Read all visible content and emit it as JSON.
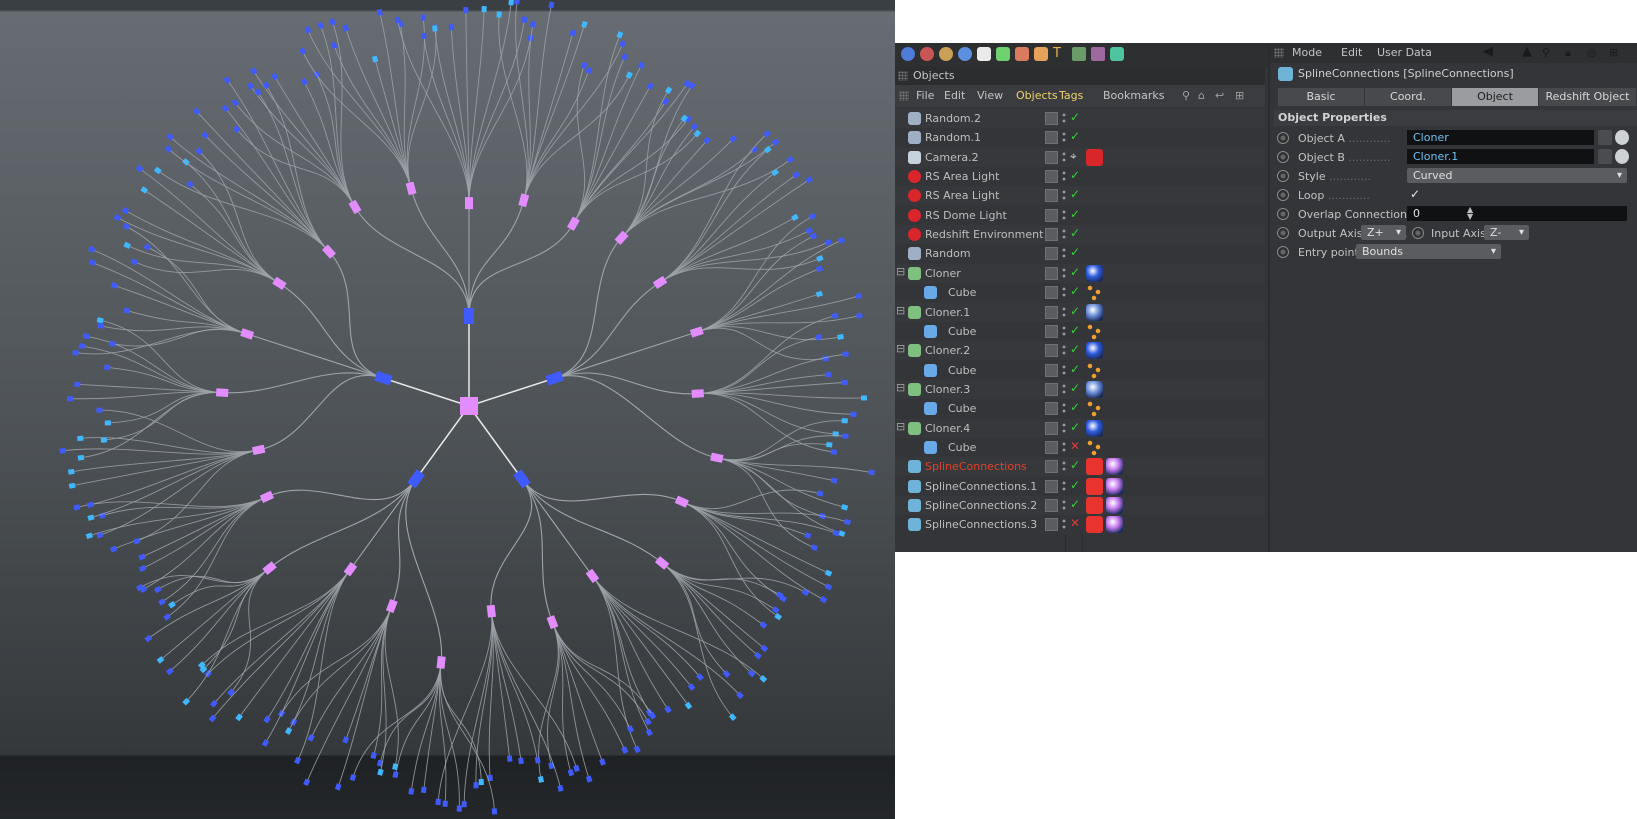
{
  "viewport": {},
  "objects_panel": {
    "title": "Objects",
    "menu": [
      "File",
      "Edit",
      "View",
      "Objects",
      "Tags",
      "Bookmarks"
    ],
    "active_menu": "Objects",
    "highlight_menu": "Tags",
    "items": [
      {
        "name": "Random.2",
        "indent": 0,
        "icon": "random-icon",
        "status": "on",
        "tags": []
      },
      {
        "name": "Random.1",
        "indent": 0,
        "icon": "random-icon",
        "status": "on",
        "tags": []
      },
      {
        "name": "Camera.2",
        "indent": 0,
        "icon": "camera-icon",
        "status": "target",
        "tags": [
          "rs-camera-tag"
        ]
      },
      {
        "name": "RS Area Light",
        "indent": 0,
        "icon": "rs-light-icon",
        "status": "on",
        "tags": []
      },
      {
        "name": "RS Area Light",
        "indent": 0,
        "icon": "rs-light-icon",
        "status": "on",
        "tags": []
      },
      {
        "name": "RS Dome Light",
        "indent": 0,
        "icon": "rs-light-icon",
        "status": "on",
        "tags": []
      },
      {
        "name": "Redshift Environment",
        "indent": 0,
        "icon": "rs-environment-icon",
        "status": "on",
        "tags": []
      },
      {
        "name": "Random",
        "indent": 0,
        "icon": "random-icon",
        "status": "on",
        "tags": []
      },
      {
        "name": "Cloner",
        "indent": 0,
        "icon": "cloner-icon",
        "status": "on",
        "tags": [
          "material-blue"
        ],
        "expand": true
      },
      {
        "name": "Cube",
        "indent": 1,
        "icon": "cube-icon",
        "status": "on",
        "tags": [
          "phong-tag"
        ]
      },
      {
        "name": "Cloner.1",
        "indent": 0,
        "icon": "cloner-icon",
        "status": "on",
        "tags": [
          "material-lightblue"
        ],
        "expand": true
      },
      {
        "name": "Cube",
        "indent": 1,
        "icon": "cube-icon",
        "status": "on",
        "tags": [
          "phong-tag"
        ]
      },
      {
        "name": "Cloner.2",
        "indent": 0,
        "icon": "cloner-icon",
        "status": "on",
        "tags": [
          "material-blue"
        ],
        "expand": true
      },
      {
        "name": "Cube",
        "indent": 1,
        "icon": "cube-icon",
        "status": "on",
        "tags": [
          "phong-tag"
        ]
      },
      {
        "name": "Cloner.3",
        "indent": 0,
        "icon": "cloner-icon",
        "status": "on",
        "tags": [
          "material-lightblue"
        ],
        "expand": true
      },
      {
        "name": "Cube",
        "indent": 1,
        "icon": "cube-icon",
        "status": "on",
        "tags": [
          "phong-tag"
        ]
      },
      {
        "name": "Cloner.4",
        "indent": 0,
        "icon": "cloner-icon",
        "status": "on",
        "tags": [
          "material-blue"
        ],
        "expand": true
      },
      {
        "name": "Cube",
        "indent": 1,
        "icon": "cube-icon",
        "status": "off",
        "tags": [
          "phong-tag"
        ]
      },
      {
        "name": "SplineConnections",
        "indent": 0,
        "icon": "spline-connections-icon",
        "status": "on",
        "tags": [
          "rs-object-tag",
          "material-pink"
        ],
        "selected": true
      },
      {
        "name": "SplineConnections.1",
        "indent": 0,
        "icon": "spline-connections-icon",
        "status": "on",
        "tags": [
          "rs-object-tag",
          "material-pink"
        ]
      },
      {
        "name": "SplineConnections.2",
        "indent": 0,
        "icon": "spline-connections-icon",
        "status": "on",
        "tags": [
          "rs-object-tag",
          "material-pink"
        ]
      },
      {
        "name": "SplineConnections.3",
        "indent": 0,
        "icon": "spline-connections-icon",
        "status": "off",
        "tags": [
          "rs-object-tag",
          "material-pink"
        ]
      }
    ]
  },
  "attributes_panel": {
    "menu": [
      "Mode",
      "Edit",
      "User Data"
    ],
    "object_title": "SplineConnections [SplineConnections]",
    "tabs": [
      "Basic",
      "Coord.",
      "Object",
      "Redshift Object"
    ],
    "active_tab": "Object",
    "section": "Object Properties",
    "props": {
      "object_a_label": "Object A",
      "object_a_value": "Cloner",
      "object_b_label": "Object B",
      "object_b_value": "Cloner.1",
      "style_label": "Style",
      "style_value": "Curved",
      "loop_label": "Loop",
      "loop_value": "✓",
      "overlap_label": "Overlap Connections",
      "overlap_value": "0",
      "output_axis_label": "Output Axis",
      "output_axis_value": "Z+",
      "input_axis_label": "Input Axis",
      "input_axis_value": "Z-",
      "entry_point_label": "Entry point",
      "entry_point_value": "Bounds"
    }
  },
  "colors": {
    "selected_name": "#e0422c",
    "active_menu": "#f1d36b",
    "check_on": "#37d13a",
    "check_off": "#e03a3a",
    "node_blue": "#3f5bff",
    "node_pink": "#e28cff",
    "spline": "#9ea5aa"
  }
}
